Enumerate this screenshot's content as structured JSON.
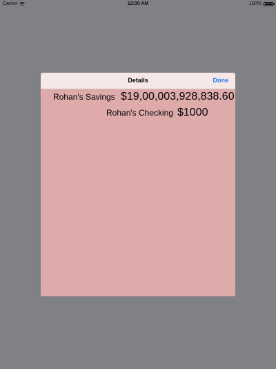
{
  "status_bar": {
    "carrier": "Carrier",
    "time": "12:00 AM",
    "battery": "100%",
    "icons": [
      "wifi-icon",
      "battery-icon"
    ]
  },
  "modal": {
    "title": "Details",
    "done_label": "Done",
    "accounts": [
      {
        "name": "Rohan's Savings",
        "amount": "$19,00,003,928,838.60"
      },
      {
        "name": "Rohan's Checking",
        "amount": "$1000"
      }
    ]
  },
  "colors": {
    "background": "#808184",
    "modal_body": "#deaaaa",
    "modal_header": "#f7e8e8",
    "accent": "#1e7cf5"
  }
}
